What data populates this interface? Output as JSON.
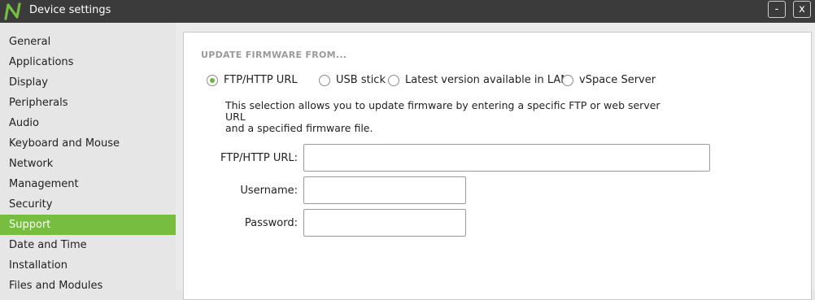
{
  "window": {
    "title": "Device settings",
    "minimize_label": "-",
    "close_label": "x",
    "logo_letter": "N",
    "brand_color": "#77bd3f"
  },
  "sidebar": {
    "items": [
      {
        "label": "General"
      },
      {
        "label": "Applications"
      },
      {
        "label": "Display"
      },
      {
        "label": "Peripherals"
      },
      {
        "label": "Audio"
      },
      {
        "label": "Keyboard and Mouse"
      },
      {
        "label": "Network"
      },
      {
        "label": "Management"
      },
      {
        "label": "Security"
      },
      {
        "label": "Support",
        "active": true
      },
      {
        "label": "Date and Time"
      },
      {
        "label": "Installation"
      },
      {
        "label": "Files and Modules"
      }
    ]
  },
  "firmware": {
    "heading": "UPDATE FIRMWARE FROM...",
    "options": [
      {
        "label": "FTP/HTTP URL",
        "selected": true
      },
      {
        "label": "USB stick",
        "selected": false
      },
      {
        "label": "Latest version available in LAN",
        "selected": false
      },
      {
        "label": "vSpace Server",
        "selected": false
      }
    ],
    "description_line1": "This selection allows you to update firmware by entering a specific FTP or web server URL",
    "description_line2": "and a specified firmware file.",
    "fields": {
      "url": {
        "label": "FTP/HTTP URL:",
        "value": ""
      },
      "username": {
        "label": "Username:",
        "value": ""
      },
      "password": {
        "label": "Password:",
        "value": ""
      }
    }
  }
}
